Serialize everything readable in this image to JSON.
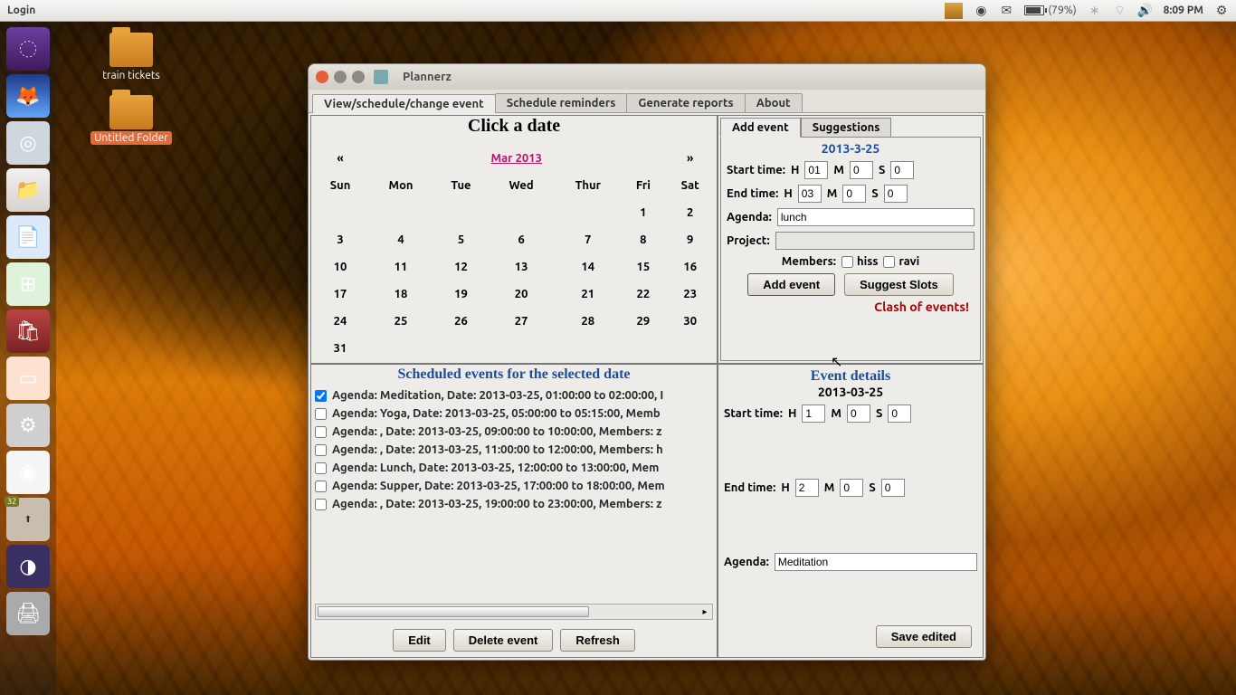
{
  "topbar": {
    "login": "Login",
    "battery_pct": "(79%)",
    "clock": "8:09 PM"
  },
  "desktop": {
    "icon1": "train tickets",
    "icon2": "Untitled Folder"
  },
  "launcher": {
    "updates_badge": "32"
  },
  "window": {
    "title": "Plannerz",
    "tabs": {
      "t1": "View/schedule/change event",
      "t2": "Schedule reminders",
      "t3": "Generate reports",
      "t4": "About"
    }
  },
  "calendar": {
    "header": "Click a date",
    "prev": "«",
    "next": "»",
    "month_label": "Mar 2013",
    "days": {
      "d0": "Sun",
      "d1": "Mon",
      "d2": "Tue",
      "d3": "Wed",
      "d4": "Thur",
      "d5": "Fri",
      "d6": "Sat"
    },
    "cells": [
      [
        "",
        "",
        "",
        "",
        "",
        "1",
        "2"
      ],
      [
        "3",
        "4",
        "5",
        "6",
        "7",
        "8",
        "9"
      ],
      [
        "10",
        "11",
        "12",
        "13",
        "14",
        "15",
        "16"
      ],
      [
        "17",
        "18",
        "19",
        "20",
        "21",
        "22",
        "23"
      ],
      [
        "24",
        "25",
        "26",
        "27",
        "28",
        "29",
        "30"
      ],
      [
        "31",
        "",
        "",
        "",
        "",
        "",
        ""
      ]
    ]
  },
  "events": {
    "header": "Scheduled events for the selected date",
    "items": [
      "Agenda: Meditation, Date: 2013-03-25, 01:00:00 to 02:00:00, I",
      "Agenda: Yoga, Date: 2013-03-25, 05:00:00 to 05:15:00, Memb",
      "Agenda: , Date: 2013-03-25, 09:00:00 to 10:00:00, Members: z",
      "Agenda: , Date: 2013-03-25, 11:00:00 to 12:00:00, Members: h",
      "Agenda: Lunch, Date: 2013-03-25, 12:00:00 to 13:00:00, Mem",
      "Agenda: Supper, Date: 2013-03-25, 17:00:00 to 18:00:00, Mem",
      "Agenda: , Date: 2013-03-25, 19:00:00 to 23:00:00, Members: z"
    ],
    "checked_index": 0,
    "btn_edit": "Edit",
    "btn_delete": "Delete event",
    "btn_refresh": "Refresh"
  },
  "add": {
    "tab_add": "Add event",
    "tab_sugg": "Suggestions",
    "date": "2013-3-25",
    "lbl_start": "Start time:",
    "lbl_end": "End time:",
    "lbl_h": "H",
    "lbl_m": "M",
    "lbl_s": "S",
    "start_h": "01",
    "start_m": "0",
    "start_s": "0",
    "end_h": "03",
    "end_m": "0",
    "end_s": "0",
    "lbl_agenda": "Agenda:",
    "agenda_val": "lunch",
    "lbl_project": "Project:",
    "project_val": "",
    "lbl_members": "Members:",
    "member1": "hiss",
    "member2": "ravi",
    "btn_add": "Add event",
    "btn_suggest": "Suggest Slots",
    "error": "Clash of events!"
  },
  "details": {
    "header": "Event details",
    "date": "2013-03-25",
    "lbl_start": "Start time:",
    "lbl_end": "End time:",
    "lbl_h": "H",
    "lbl_m": "M",
    "lbl_s": "S",
    "start_h": "1",
    "start_m": "0",
    "start_s": "0",
    "end_h": "2",
    "end_m": "0",
    "end_s": "0",
    "lbl_agenda": "Agenda:",
    "agenda_val": "Meditation",
    "btn_save": "Save edited"
  }
}
